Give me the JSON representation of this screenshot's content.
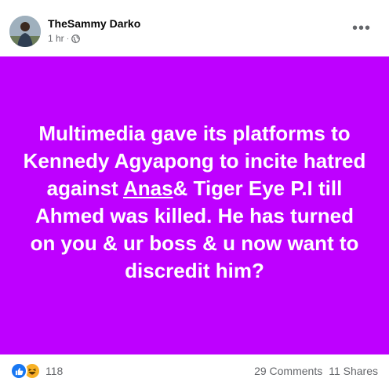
{
  "post": {
    "author": "TheSammy Darko",
    "time": "1 hr",
    "separator": "·",
    "more_label": "•••",
    "text_before": "Multimedia gave its platforms to Kennedy Agyapong to incite hatred against ",
    "text_underlined": "Anas",
    "text_after": "& Tiger Eye P.I till Ahmed was killed. He has turned on you & ur boss & u now want to discredit him?",
    "background_color": "#be00ff"
  },
  "footer": {
    "reaction_icons": [
      "like-icon",
      "haha-icon"
    ],
    "reaction_count": "118",
    "comments": "29 Comments",
    "shares": "11 Shares"
  }
}
